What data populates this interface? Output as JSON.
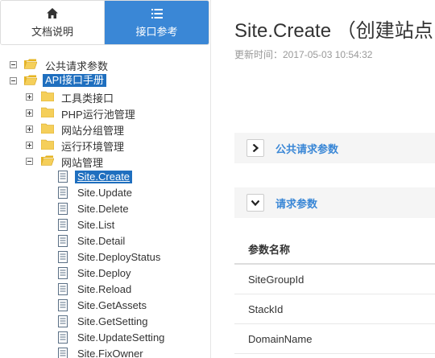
{
  "sidebar": {
    "tabs": [
      {
        "label": "文档说明",
        "icon": "home-icon"
      },
      {
        "label": "接口参考",
        "icon": "list-icon"
      }
    ],
    "tree": [
      {
        "label": "公共请求参数",
        "toggle": "minus"
      },
      {
        "label": "API接口手册",
        "toggle": "minus"
      },
      {
        "label": "工具类接口",
        "toggle": "plus"
      },
      {
        "label": "PHP运行池管理",
        "toggle": "plus"
      },
      {
        "label": "网站分组管理",
        "toggle": "plus"
      },
      {
        "label": "运行环境管理",
        "toggle": "plus"
      },
      {
        "label": "网站管理",
        "toggle": "minus"
      },
      {
        "label": "Site.Create"
      },
      {
        "label": "Site.Update"
      },
      {
        "label": "Site.Delete"
      },
      {
        "label": "Site.List"
      },
      {
        "label": "Site.Detail"
      },
      {
        "label": "Site.DeployStatus"
      },
      {
        "label": "Site.Deploy"
      },
      {
        "label": "Site.Reload"
      },
      {
        "label": "Site.GetAssets"
      },
      {
        "label": "Site.GetSetting"
      },
      {
        "label": "Site.UpdateSetting"
      },
      {
        "label": "Site.FixOwner"
      }
    ]
  },
  "main": {
    "title": "Site.Create （创建站点",
    "updated": "更新时间：2017-05-03 10:54:32",
    "sections": [
      {
        "title": "公共请求参数",
        "state": "collapsed"
      },
      {
        "title": "请求参数",
        "state": "expanded"
      }
    ],
    "param_table": {
      "header": "参数名称",
      "rows": [
        "SiteGroupId",
        "StackId",
        "DomainName"
      ]
    }
  },
  "colors": {
    "accent": "#3a87d6",
    "selection": "#1f6fbf",
    "folder": "#f0c040"
  }
}
